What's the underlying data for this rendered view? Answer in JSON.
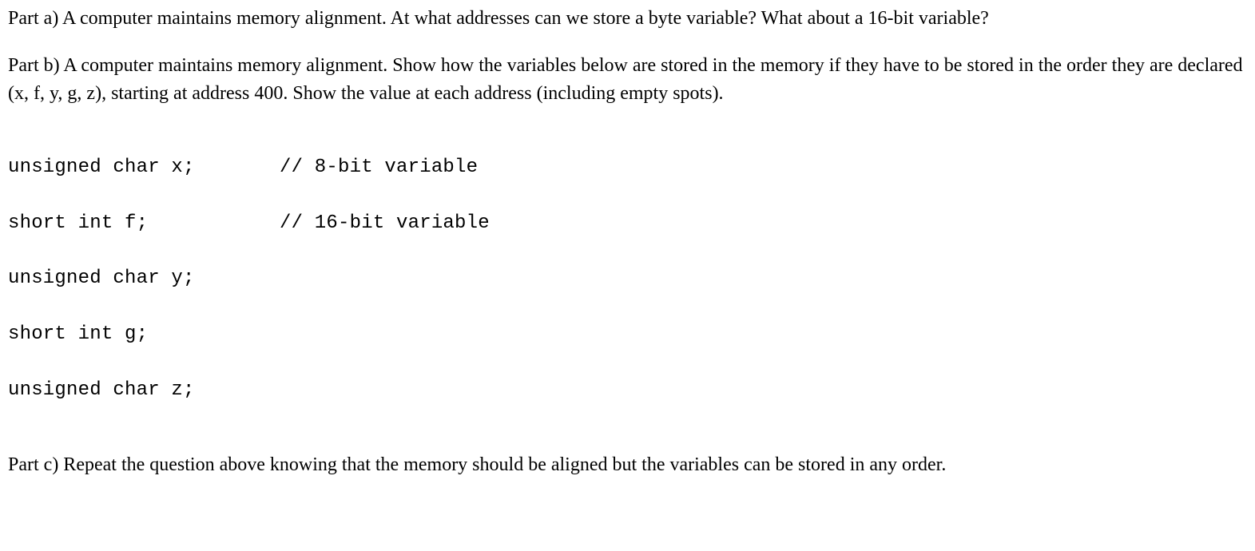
{
  "partA": "Part a) A computer maintains memory alignment. At what addresses can we store a byte variable? What about a 16-bit variable?",
  "partB": "Part b) A computer maintains memory alignment. Show how the variables below are stored in the memory if they have to be stored in the order they are declared (x, f, y, g, z), starting at address 400. Show the value at each address (including empty spots).",
  "code": {
    "rows": [
      {
        "decl": "unsigned char x;",
        "comment": "// 8-bit variable"
      },
      {
        "decl": "short int f;",
        "comment": "// 16-bit variable"
      },
      {
        "decl": "unsigned char y;",
        "comment": ""
      },
      {
        "decl": "short int g;",
        "comment": ""
      },
      {
        "decl": "unsigned char z;",
        "comment": ""
      }
    ]
  },
  "partC": "Part c) Repeat the question above knowing that the memory should be aligned but the variables can be stored in any order."
}
